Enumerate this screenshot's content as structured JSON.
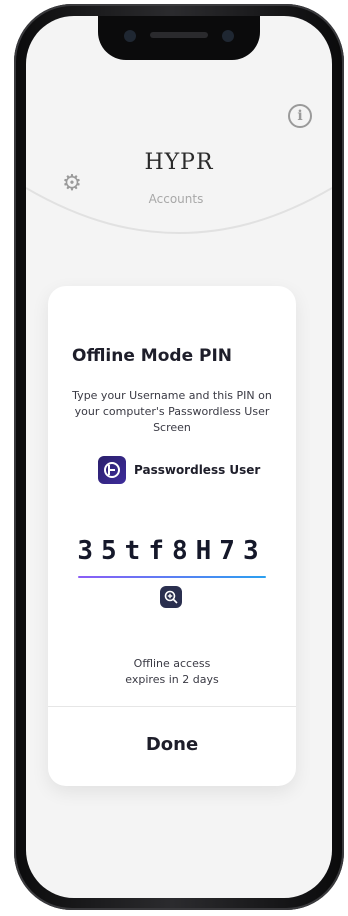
{
  "app": {
    "logo_text": "HYPR",
    "accounts_label": "Accounts"
  },
  "card": {
    "title": "Offline Mode PIN",
    "instructions": "Type your Username and this PIN on your computer's Passwordless User Screen",
    "user_label": "Passwordless User",
    "pin": "35tf8H73",
    "expires_text_line1": "Offline access",
    "expires_text_line2": "expires in 2 days",
    "done_label": "Done"
  },
  "icons": {
    "settings": "gear-icon",
    "info": "info-icon",
    "app_user": "passwordless-user-icon",
    "zoom": "zoom-in-icon"
  },
  "colors": {
    "pin_underline_start": "#8b5cf6",
    "pin_underline_end": "#2aa0f0",
    "brand_dark": "#2a1f6b"
  }
}
